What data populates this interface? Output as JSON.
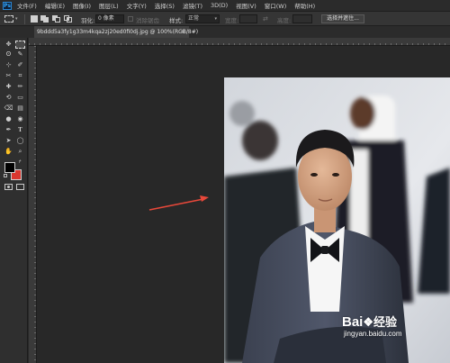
{
  "menubar": {
    "logo": "Ps",
    "items": [
      "文件(F)",
      "编辑(E)",
      "图像(I)",
      "图层(L)",
      "文字(Y)",
      "选择(S)",
      "滤镜(T)",
      "3D(D)",
      "视图(V)",
      "窗口(W)",
      "帮助(H)"
    ]
  },
  "options": {
    "feather_label": "羽化:",
    "feather_value": "0 像素",
    "antialias_label": "消除锯齿",
    "style_label": "样式:",
    "style_value": "正常",
    "width_label": "宽度:",
    "height_label": "高度:",
    "select_mask_button": "选择并遮住..."
  },
  "document": {
    "tab_title": "9bddd5a3fy1g33m4kqa2zj20ed0fi0dj.jpg @ 100%(RGB/8#)",
    "tab_close": "×"
  },
  "tools": {
    "glyphs": [
      "✥",
      "⬚",
      "ʘ",
      "✎",
      "⊹",
      "✐",
      "✂",
      "⌗",
      "✚",
      "✏",
      "⟲",
      "▭",
      "⌫",
      "▤",
      "●",
      "◉",
      "✒",
      "T",
      "➤",
      "◯",
      "✋",
      "⌕",
      "⋯"
    ]
  },
  "colors": {
    "foreground": "#000000",
    "background": "#d9362e",
    "arrow": "#e8483a"
  },
  "watermark": {
    "brand_left": "Bai",
    "brand_right": "经验",
    "url": "jingyan.baidu.com"
  }
}
